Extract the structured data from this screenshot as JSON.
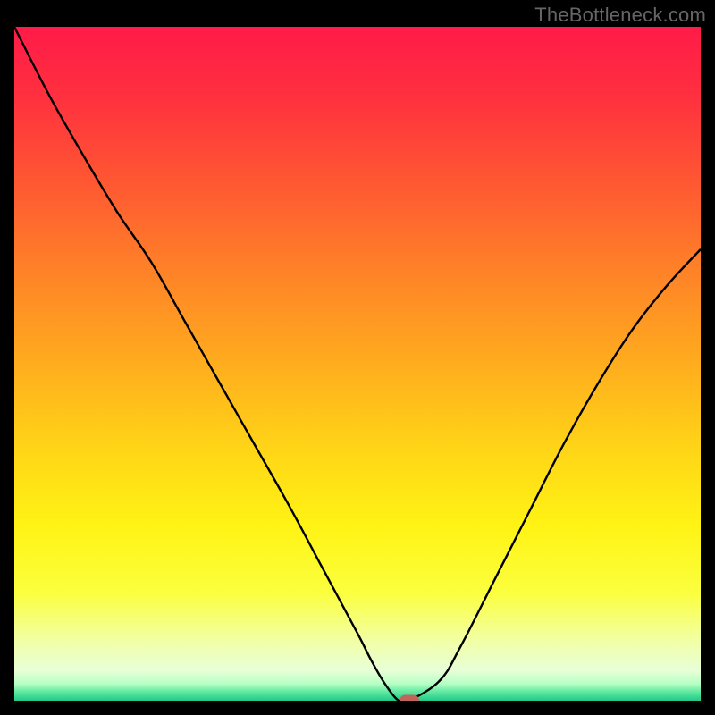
{
  "watermark": "TheBottleneck.com",
  "colors": {
    "gradient_stops": [
      {
        "offset": 0.0,
        "color": "#ff1b49"
      },
      {
        "offset": 0.1,
        "color": "#ff2f3f"
      },
      {
        "offset": 0.22,
        "color": "#ff5433"
      },
      {
        "offset": 0.35,
        "color": "#ff7e29"
      },
      {
        "offset": 0.48,
        "color": "#ffa61f"
      },
      {
        "offset": 0.62,
        "color": "#ffd317"
      },
      {
        "offset": 0.74,
        "color": "#fff314"
      },
      {
        "offset": 0.84,
        "color": "#fbff3e"
      },
      {
        "offset": 0.91,
        "color": "#f2ffa4"
      },
      {
        "offset": 0.955,
        "color": "#e8ffd8"
      },
      {
        "offset": 0.975,
        "color": "#b6ffc4"
      },
      {
        "offset": 0.987,
        "color": "#5fe8a0"
      },
      {
        "offset": 1.0,
        "color": "#20c98a"
      }
    ],
    "curve_stroke": "#000000",
    "marker_fill": "#c1645b"
  },
  "chart_data": {
    "type": "line",
    "title": "",
    "xlabel": "",
    "ylabel": "",
    "xlim": [
      0,
      100
    ],
    "ylim": [
      0,
      100
    ],
    "grid": false,
    "x": [
      0,
      5,
      10,
      15,
      20,
      25,
      30,
      35,
      40,
      45,
      50,
      52,
      54,
      56,
      57.5,
      62,
      65,
      70,
      75,
      80,
      85,
      90,
      95,
      100
    ],
    "values": [
      100,
      90,
      81,
      72.5,
      65,
      56,
      47,
      38,
      29,
      19.5,
      10,
      6,
      2.5,
      0,
      0,
      3,
      8,
      18,
      28,
      38,
      47,
      55,
      61.5,
      67
    ],
    "flat_segment": {
      "x0": 56,
      "x1": 57.5,
      "y": 0
    },
    "marker": {
      "x": 57.5,
      "y": 0
    },
    "annotations": []
  },
  "layout": {
    "outer_w": 800,
    "outer_h": 800,
    "inner_left": 16,
    "inner_top": 30,
    "inner_w": 768,
    "inner_h": 754
  }
}
